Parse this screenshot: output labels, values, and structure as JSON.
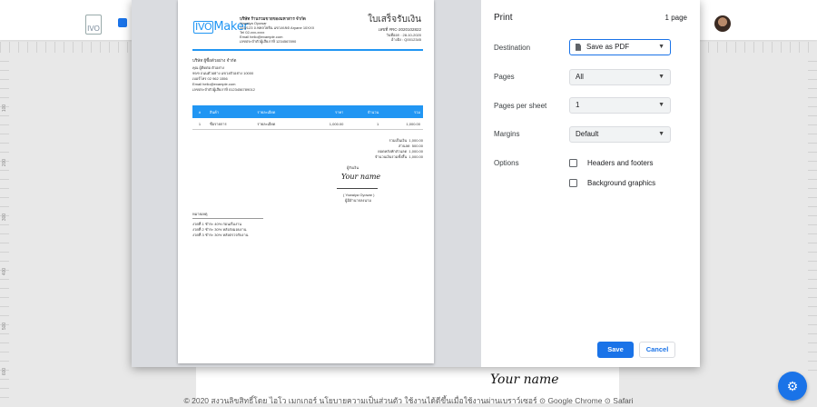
{
  "app": {
    "logo_text": "IVO",
    "footer": "© 2020 สงวนลิขสิทธิ์โดย ไอโว เมกเกอร์ นโยบายความเป็นส่วนตัว ใช้งานได้ดีขึ้นเมื่อใช้งานผ่านเบราว์เซอร์ ⊙ Google Chrome ⊙ Safari",
    "signature_text": "Your name",
    "fab_icon": "gear-icon"
  },
  "ruler": [
    "100",
    "200",
    "300",
    "400",
    "500",
    "600",
    "700"
  ],
  "print": {
    "title": "Print",
    "page_count": "1 page",
    "destination_label": "Destination",
    "destination_value": "Save as PDF",
    "pages_label": "Pages",
    "pages_value": "All",
    "pages_per_sheet_label": "Pages per sheet",
    "pages_per_sheet_value": "1",
    "margins_label": "Margins",
    "margins_value": "Default",
    "options_label": "Options",
    "option_headers": "Headers and footers",
    "option_background": "Background graphics",
    "save_label": "Save",
    "cancel_label": "Cancel"
  },
  "receipt": {
    "logo_box": "IVO",
    "logo_rest": "Maker",
    "company_name": "บริษัท ร้านรวมขายของมหาสาร จำกัด",
    "company_lines": [
      "Yowaiya Oyowar",
      "123/123 ถ.พหลโยธิน แขวง/เขต Aryane 10XXX",
      "Tel 02-xxx-xxxx",
      "Email hello@example.com",
      "เลขประจำตัวผู้เสียภาษี 1234567890"
    ],
    "title": "ใบเสร็จรับเงิน",
    "doc_no": "เลขที่ #RC-2020102822",
    "doc_date": "วันที่ออก : 28-10-2020",
    "doc_ref": "อ้างอิง : Q0012345",
    "customer_name": "บริษัท ผู้ซื้อตัวอย่าง จำกัด",
    "customer_lines": [
      "คุณ ผู้ติดต่อ ตัวอย่าง",
      "99/9 ถนนตัวอย่าง แขวงตัวอย่าง 10000",
      "เบอร์โทร 02 962 1556",
      "Email hello@example.com",
      "เลขประจำตัวผู้เสียภาษี 0123456789012"
    ],
    "table_headers": [
      "#",
      "สินค้า",
      "รายละเอียด",
      "ราคา",
      "จำนวน",
      "รวม"
    ],
    "table_row": [
      "1",
      "ชื่อรายการ",
      "รายละเอียด",
      "1,000.00",
      "1",
      "1,000.00"
    ],
    "totals": [
      {
        "label": "รวมเป็นเงิน",
        "value": "1,000.00"
      },
      {
        "label": "ส่วนลด",
        "value": "500.00"
      },
      {
        "label": "ยอดหลังหักส่วนลด",
        "value": "1,000.00"
      },
      {
        "label": "จำนวนเงินรวมทั้งสิ้น",
        "value": "1,000.00"
      }
    ],
    "sign_caption": "ผู้รับเงิน",
    "signature": "Your name",
    "sign_name": "( Yowaiya Oyowar )",
    "sign_role": "ผู้มีอำนาจลงนาม",
    "notes_title": "หมายเหตุ",
    "notes_lines": [
      "งวดที่ 1 ชำระ 40% ก่อนเริ่มงาน",
      "งวดที่ 2 ชำระ 30% หลังส่งมอบงาน",
      "งวดที่ 3 ชำระ 30% หลังตรวจรับงาน"
    ]
  }
}
